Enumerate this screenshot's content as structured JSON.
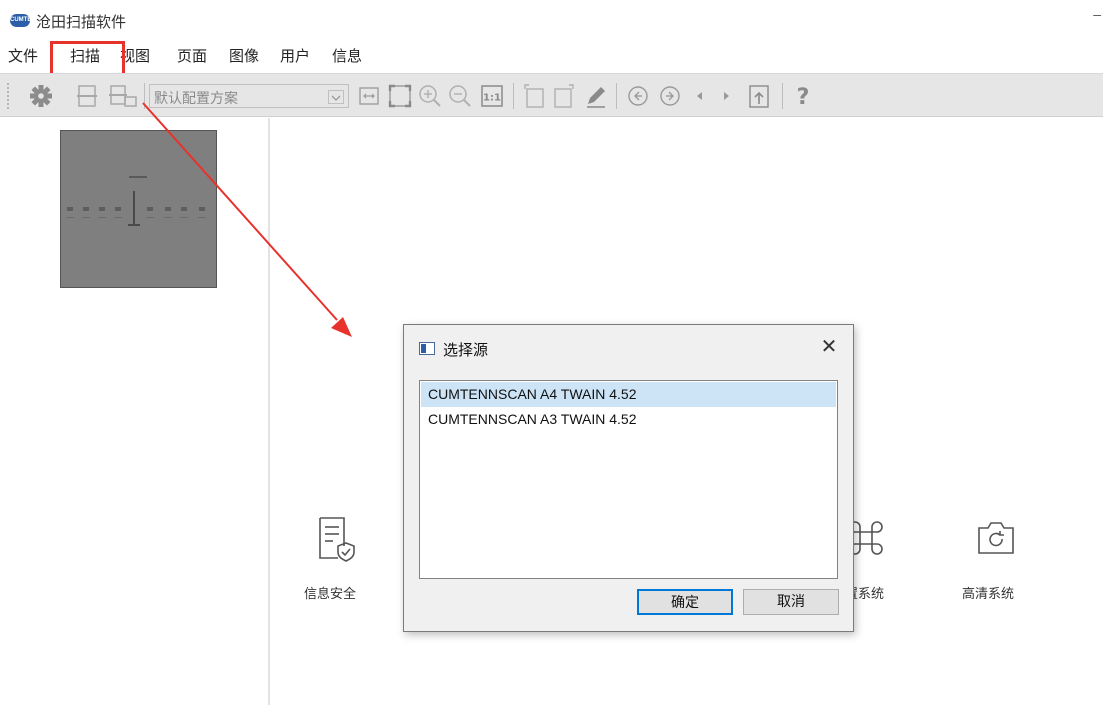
{
  "window": {
    "title": "沧田扫描软件",
    "logo_text": "CUMTENN",
    "minimize_glyph": "–"
  },
  "menu": {
    "items": [
      "文件",
      "扫描",
      "视图",
      "页面",
      "图像",
      "用户",
      "信息"
    ]
  },
  "toolbar": {
    "profile_select": {
      "value": "默认配置方案"
    },
    "help_glyph": "?"
  },
  "features": [
    {
      "label": "信息安全",
      "icon": "document-shield-icon"
    },
    {
      "label": "内置系统",
      "icon": "command-icon"
    },
    {
      "label": "高清系统",
      "icon": "camera-icon"
    }
  ],
  "dialog": {
    "title": "选择源",
    "close_glyph": "✕",
    "sources": [
      {
        "name": "CUMTENNSCAN A4 TWAIN 4.52",
        "selected": true
      },
      {
        "name": "CUMTENNSCAN A3 TWAIN 4.52",
        "selected": false
      }
    ],
    "ok_label": "确定",
    "cancel_label": "取消"
  },
  "colors": {
    "annotation_red": "#e8322c",
    "toolbar_bg": "#e6e6e6",
    "selection_bg": "#cde4f7",
    "default_button_border": "#0078d7"
  }
}
